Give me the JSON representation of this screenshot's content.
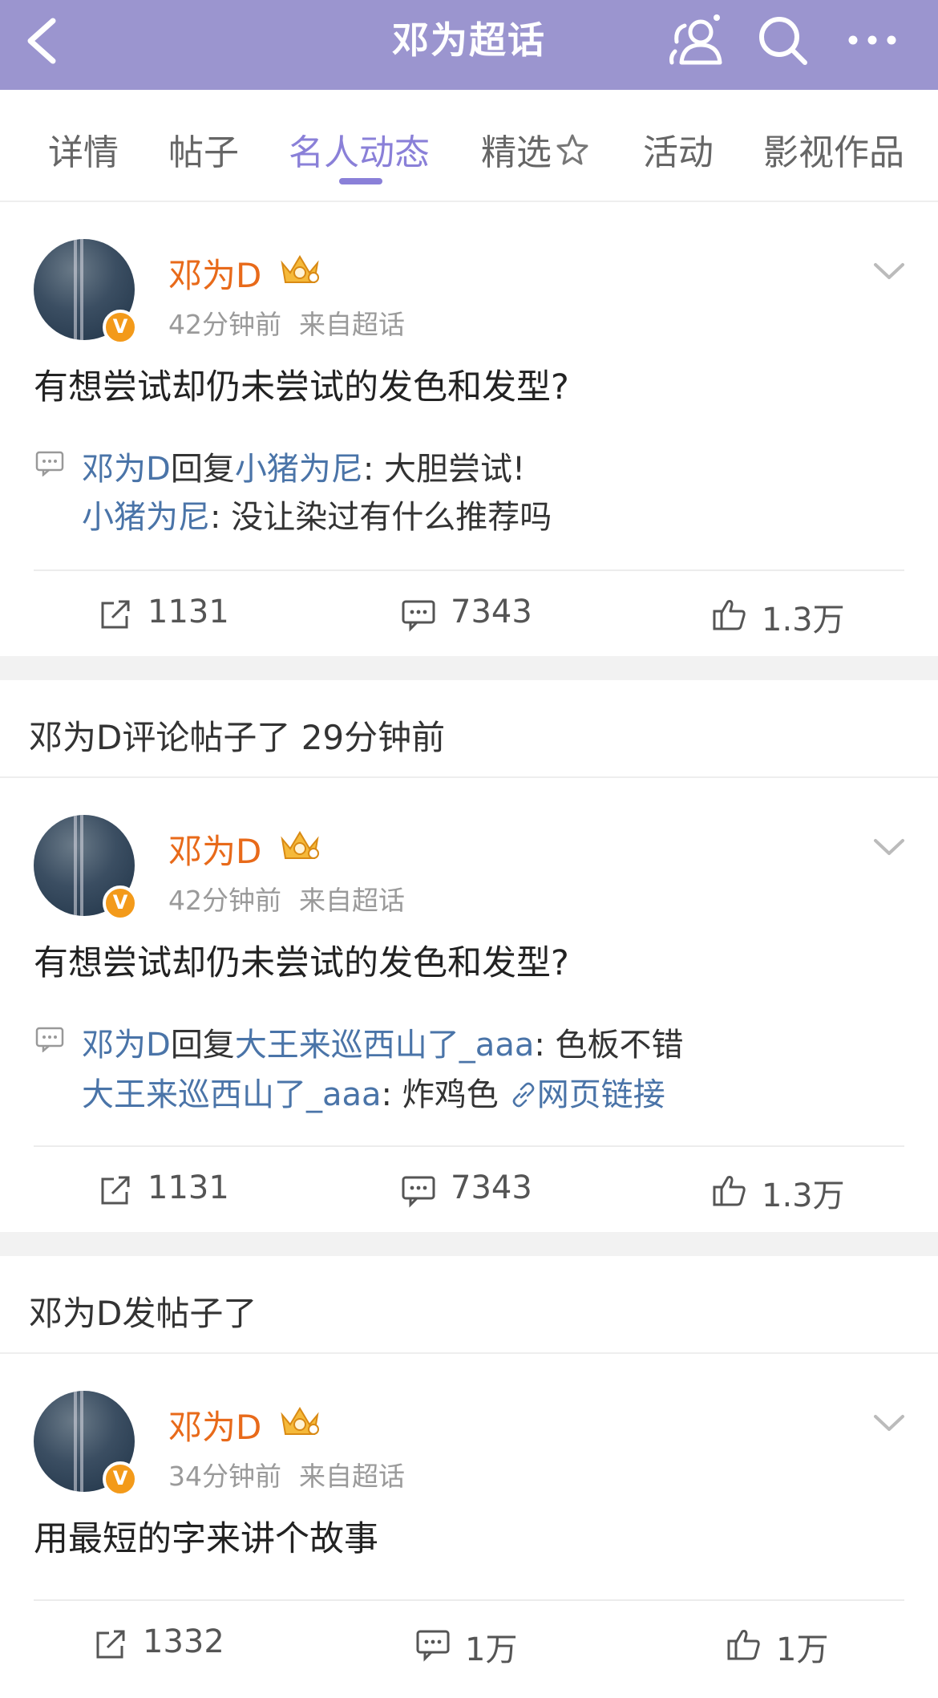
{
  "header": {
    "title": "邓为超话",
    "icons": [
      "back-icon",
      "people-icon",
      "search-icon",
      "more-icon"
    ]
  },
  "tabs": [
    {
      "label": "详情",
      "active": false
    },
    {
      "label": "帖子",
      "active": false
    },
    {
      "label": "名人动态",
      "active": true
    },
    {
      "label": "精选",
      "active": false
    },
    {
      "label": "活动",
      "active": false
    },
    {
      "label": "影视作品",
      "active": false
    }
  ],
  "posts": [
    {
      "author": "邓为D",
      "time": "42分钟前",
      "source": "来自超话",
      "text": "有想尝试却仍未尝试的发色和发型?",
      "reply": {
        "replier": "邓为D",
        "verb": "回复",
        "target": "小猪为尼",
        "content": ": 大胆尝试!"
      },
      "quote": {
        "user": "小猪为尼",
        "content": ": 没让染过有什么推荐吗",
        "link": ""
      },
      "reposts": "1131",
      "comments": "7343",
      "likes": "1.3万"
    },
    {
      "author": "邓为D",
      "time": "42分钟前",
      "source": "来自超话",
      "text": "有想尝试却仍未尝试的发色和发型?",
      "reply": {
        "replier": "邓为D",
        "verb": "回复",
        "target": "大王来巡西山了_aaa",
        "content": ": 色板不错"
      },
      "quote": {
        "user": "大王来巡西山了_aaa",
        "content": ": 炸鸡色",
        "link": "网页链接"
      },
      "reposts": "1131",
      "comments": "7343",
      "likes": "1.3万"
    },
    {
      "author": "邓为D",
      "time": "34分钟前",
      "source": "来自超话",
      "text": "用最短的字来讲个故事",
      "reposts": "1332",
      "comments": "1万",
      "likes": "1万"
    }
  ],
  "sections": [
    {
      "label": "邓为D评论帖子了 29分钟前"
    },
    {
      "label": "邓为D发帖子了"
    }
  ],
  "colors": {
    "header_bg": "#9b95cf",
    "active_tab": "#8a80d8",
    "name": "#e86a1a",
    "link_blue": "#4a74a8"
  }
}
